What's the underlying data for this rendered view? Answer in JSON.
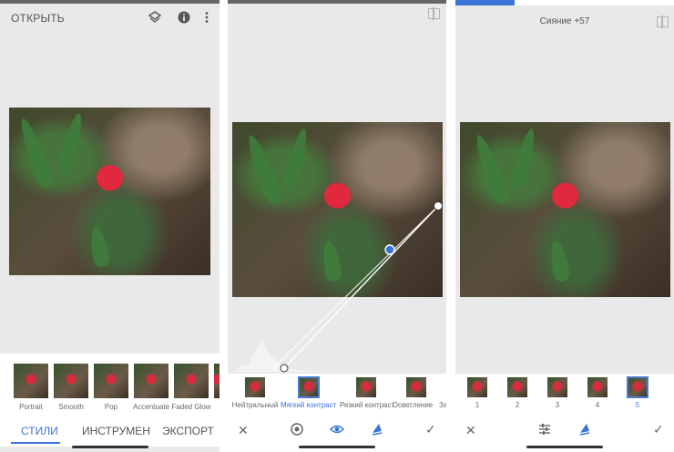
{
  "screen1": {
    "open_label": "ОТКРЫТЬ",
    "styles": [
      "Portrait",
      "Smooth",
      "Pop",
      "Accentuate",
      "Faded Glow"
    ],
    "tabs": [
      "СТИЛИ",
      "ИНСТРУМЕН",
      "ЭКСПОРТ"
    ],
    "icons": [
      "layers-icon",
      "info-icon",
      "more-icon"
    ]
  },
  "screen2": {
    "presets": [
      "Нейтральный",
      "Мягкий контраст",
      "Резкий контраст",
      "Осветление",
      "За"
    ],
    "selected_preset_index": 1,
    "bottom_icons": [
      "close-icon",
      "circle-tool-icon",
      "eye-icon",
      "styles-icon",
      "check-icon"
    ]
  },
  "screen3": {
    "status": "Сияние +57",
    "progress_fraction": 0.27,
    "variations": [
      "1",
      "2",
      "3",
      "4",
      "5"
    ],
    "selected_variation_index": 4,
    "bottom_icons": [
      "close-icon",
      "sliders-icon",
      "styles-icon",
      "check-icon"
    ]
  },
  "colors": {
    "accent": "#3b74d8",
    "panel_bg": "#e9e9e9",
    "text": "#555555"
  }
}
